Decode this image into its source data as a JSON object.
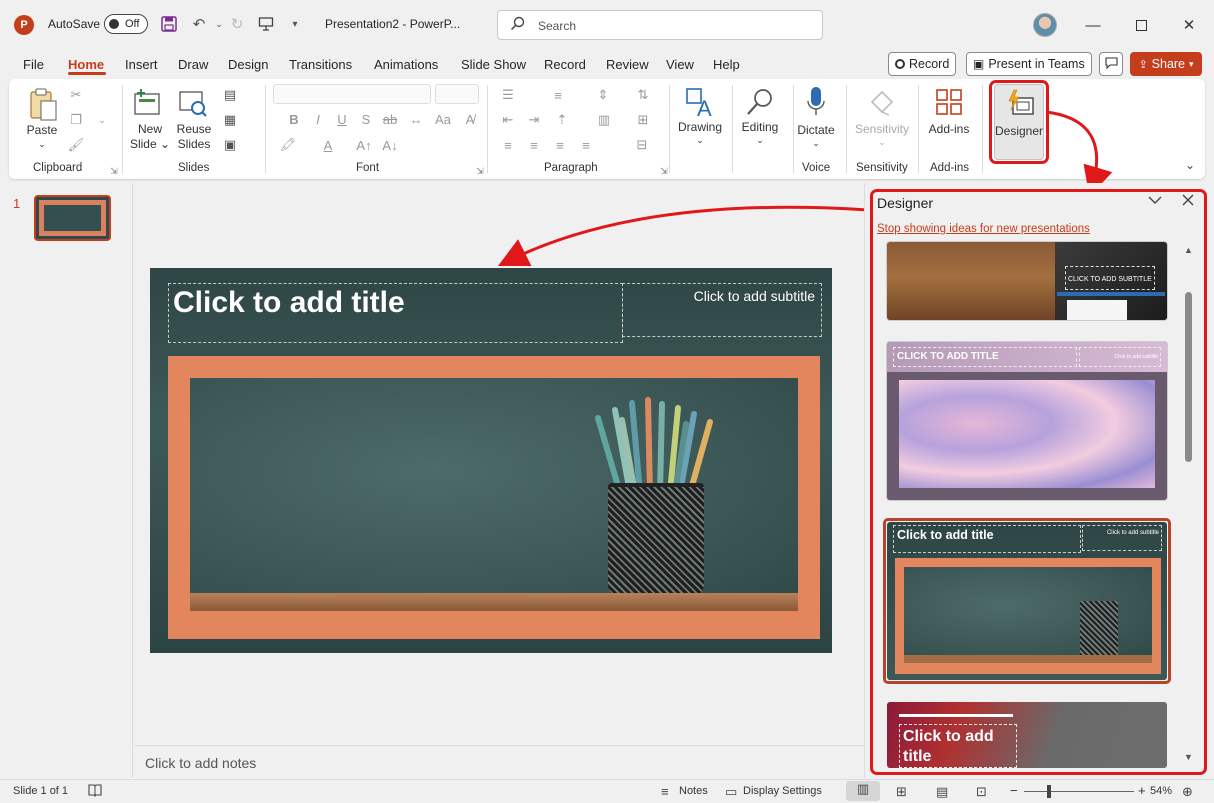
{
  "titlebar": {
    "app_logo": "P",
    "autosave_label": "AutoSave",
    "autosave_state": "Off",
    "doc_title": "Presentation2  -  PowerP...",
    "search_placeholder": "Search",
    "icons": [
      "save-icon",
      "undo-icon",
      "redo-icon",
      "slideshow-from-start-icon",
      "customize-qat-icon",
      "minimize-icon",
      "maximize-icon",
      "close-icon"
    ]
  },
  "menu": {
    "tabs": [
      "File",
      "Home",
      "Insert",
      "Draw",
      "Design",
      "Transitions",
      "Animations",
      "Slide Show",
      "Record",
      "Review",
      "View",
      "Help"
    ],
    "active_tab": "Home",
    "record_label": "Record",
    "present_label": "Present in Teams",
    "share_label": "Share"
  },
  "ribbon": {
    "paste_label": "Paste",
    "new_slide_label": "New Slide",
    "reuse_slides_label": "Reuse Slides",
    "drawing_label": "Drawing",
    "editing_label": "Editing",
    "dictate_label": "Dictate",
    "sensitivity_label": "Sensitivity",
    "addins_label": "Add-ins",
    "designer_label": "Designer",
    "groups": {
      "clipboard": "Clipboard",
      "slides": "Slides",
      "font": "Font",
      "paragraph": "Paragraph",
      "voice": "Voice",
      "sensitivity": "Sensitivity",
      "addins": "Add-ins"
    },
    "font_buttons": [
      "B",
      "I",
      "U",
      "S",
      "ab",
      "A",
      "A"
    ]
  },
  "thumbnails": {
    "slide_number": "1"
  },
  "slide": {
    "title_placeholder": "Click to add title",
    "subtitle_placeholder": "Click to add subtitle"
  },
  "notes": {
    "placeholder": "Click to add notes"
  },
  "designer": {
    "title": "Designer",
    "stop_link": "Stop showing ideas for new presentations",
    "ideas": {
      "idea1_subtitle": "CLICK TO ADD SUBTITLE",
      "idea2_title": "CLICK TO ADD TITLE",
      "idea2_subtitle": "Click to add subtitle",
      "idea3_title": "Click to add title",
      "idea3_subtitle": "Click to add subtitle",
      "idea4_title": "Click to add title"
    }
  },
  "status": {
    "slide_count": "Slide 1 of 1",
    "notes_label": "Notes",
    "display_settings_label": "Display Settings",
    "zoom_level": "54%",
    "zoom_minus": "−",
    "zoom_plus": "+"
  },
  "colors": {
    "accent": "#c43e1c",
    "highlight": "#e0181a",
    "slide_frame": "#e3865e"
  }
}
